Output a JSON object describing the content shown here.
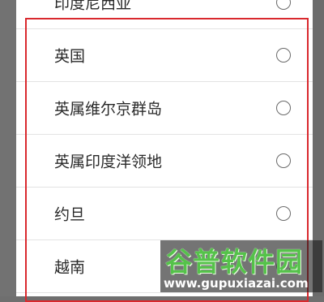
{
  "countries": [
    {
      "label": "印度尼西亚",
      "selected": false
    },
    {
      "label": "英国",
      "selected": false
    },
    {
      "label": "英属维尔京群岛",
      "selected": false
    },
    {
      "label": "英属印度洋领地",
      "selected": false
    },
    {
      "label": "约旦",
      "selected": false
    },
    {
      "label": "越南",
      "selected": false
    }
  ],
  "watermark": {
    "title": "谷普软件园",
    "url": "www.gupuxiazai.com"
  },
  "colors": {
    "highlight_border": "#d9292e",
    "watermark_green": "#55c24a",
    "overlay": "#6f6f6f"
  }
}
